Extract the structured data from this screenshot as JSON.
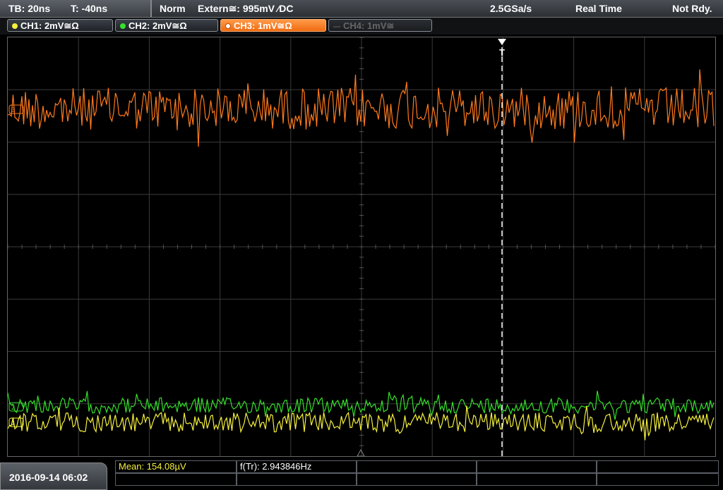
{
  "topbar": {
    "timebase": "TB: 20ns",
    "trigger_time": "T: -40ns",
    "mode": "Norm",
    "trigger_source": "Extern≅: 995mV ⁄DC",
    "sample_rate": "2.5GSa/s",
    "acq_mode": "Real Time",
    "status": "Not Rdy."
  },
  "channels": [
    {
      "label": "CH1: 2mV≅Ω",
      "color": "#f5f03c"
    },
    {
      "label": "CH2: 2mV≅Ω",
      "color": "#35e02a"
    },
    {
      "label": "CH3: 1mV≅Ω",
      "color": "#ff7a1c"
    },
    {
      "label": "CH4: 1mV≅",
      "color": "#555555"
    }
  ],
  "measurements": {
    "mean": "Mean: 154.08µV",
    "freq": "f(Tr): 2.943846Hz"
  },
  "datetime": "2016-09-14 06:02",
  "colors": {
    "grid": "#3a3a3a",
    "ch1": "#f5f03c",
    "ch2": "#35e02a",
    "ch3": "#ff7a1c",
    "trigger_line": "#ffffff"
  }
}
